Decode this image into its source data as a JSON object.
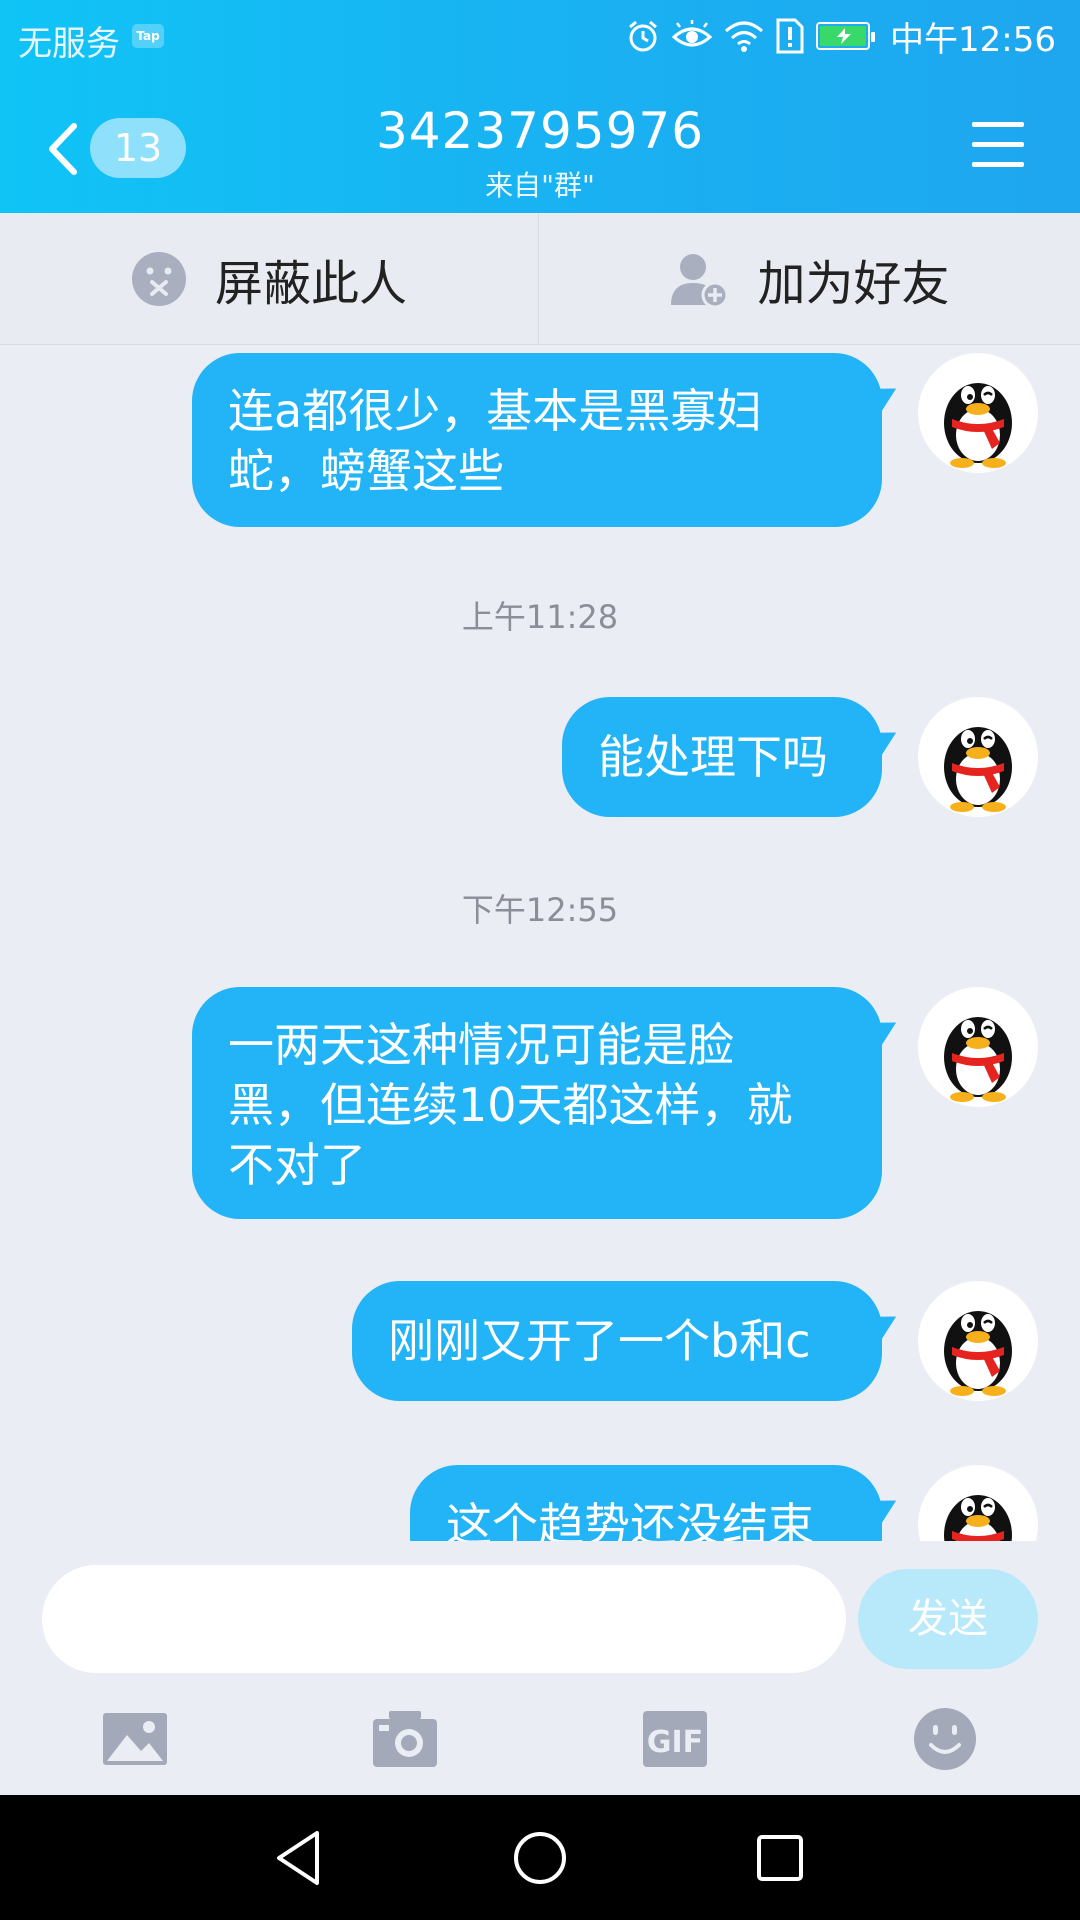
{
  "status_bar": {
    "carrier": "无服务",
    "tap_badge": "Tap",
    "time": "中午12:56",
    "icons": [
      "alarm-icon",
      "eye-icon",
      "wifi-icon",
      "alert-sim-icon",
      "battery-charging-icon"
    ],
    "battery_color": "#38d86a"
  },
  "header": {
    "back_icon": "chevron-left-icon",
    "unread_count": "13",
    "title": "3423795976",
    "subtitle": "来自\"群\"",
    "menu_icon": "menu-icon",
    "gradient": [
      "#10c4f6",
      "#1ea6ef"
    ]
  },
  "action_bar": {
    "block_label": "屏蔽此人",
    "block_icon": "block-face-icon",
    "add_friend_label": "加为好友",
    "add_friend_icon": "add-friend-icon"
  },
  "messages": [
    {
      "type": "message",
      "lines": [
        "连a都很少，基本是黑寡妇",
        "蛇，螃蟹这些"
      ]
    },
    {
      "type": "time",
      "text": "上午11:28"
    },
    {
      "type": "message",
      "lines": [
        "能处理下吗"
      ]
    },
    {
      "type": "time",
      "text": "下午12:55"
    },
    {
      "type": "message",
      "lines": [
        "一两天这种情况可能是脸",
        "黑，但连续10天都这样，就",
        "不对了"
      ]
    },
    {
      "type": "message",
      "lines": [
        "刚刚又开了一个b和c"
      ]
    },
    {
      "type": "message",
      "lines": [
        "这个趋势还没结束"
      ]
    }
  ],
  "bubble_color": "#22b4f6",
  "input": {
    "value": "",
    "placeholder": "",
    "send_label": "发送",
    "send_color": "#b7e9fb"
  },
  "toolbar": [
    "image-icon",
    "camera-icon",
    "gif-icon",
    "emoji-icon"
  ],
  "toolbar_labels": {
    "gif": "GIF"
  },
  "nav_bar": [
    "back-triangle-icon",
    "home-circle-icon",
    "recents-square-icon"
  ]
}
